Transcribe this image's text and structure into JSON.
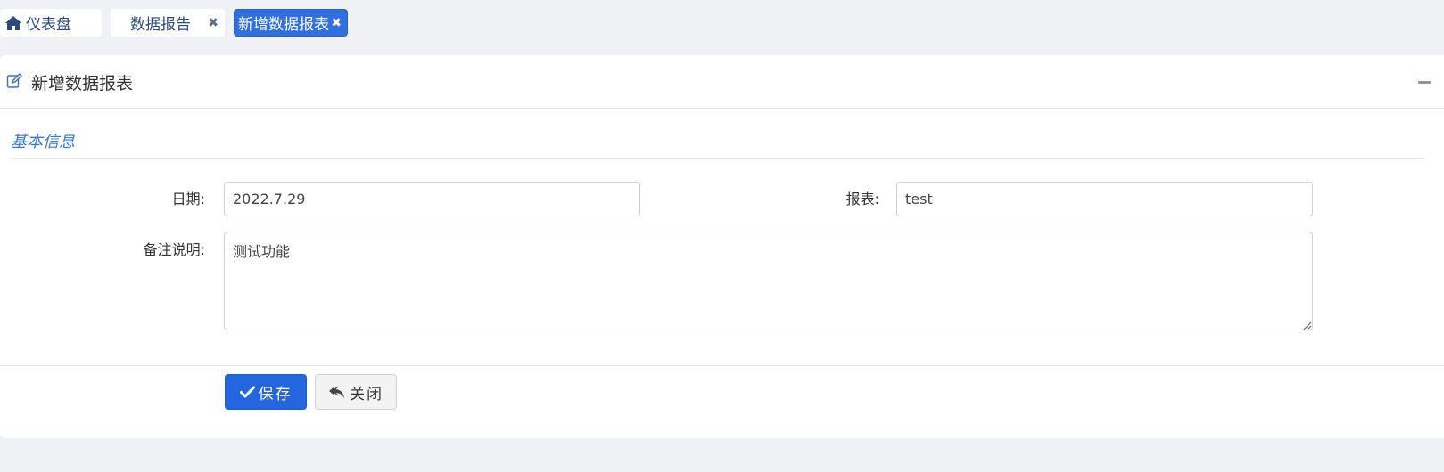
{
  "tabs": [
    {
      "label": "仪表盘",
      "icon": "home-icon",
      "closable": false,
      "active": false
    },
    {
      "label": "数据报告",
      "icon": null,
      "closable": true,
      "active": false
    },
    {
      "label": "新增数据报表",
      "icon": null,
      "closable": true,
      "active": true
    }
  ],
  "colors": {
    "accent": "#2f6fe0",
    "primary_button": "#2466df",
    "section_title": "#3a78d4",
    "background": "#eff1f5"
  },
  "panel": {
    "title": "新增数据报表",
    "title_icon": "edit-icon",
    "collapse_icon": "minus-icon",
    "section_title": "基本信息"
  },
  "form": {
    "date_label": "日期:",
    "date_value": "2022.7.29",
    "report_label": "报表:",
    "report_value": "test",
    "notes_label": "备注说明:",
    "notes_value": "测试功能"
  },
  "buttons": {
    "save_label": "保存",
    "save_icon": "check-icon",
    "close_label": "关闭",
    "close_icon": "reply-icon"
  }
}
